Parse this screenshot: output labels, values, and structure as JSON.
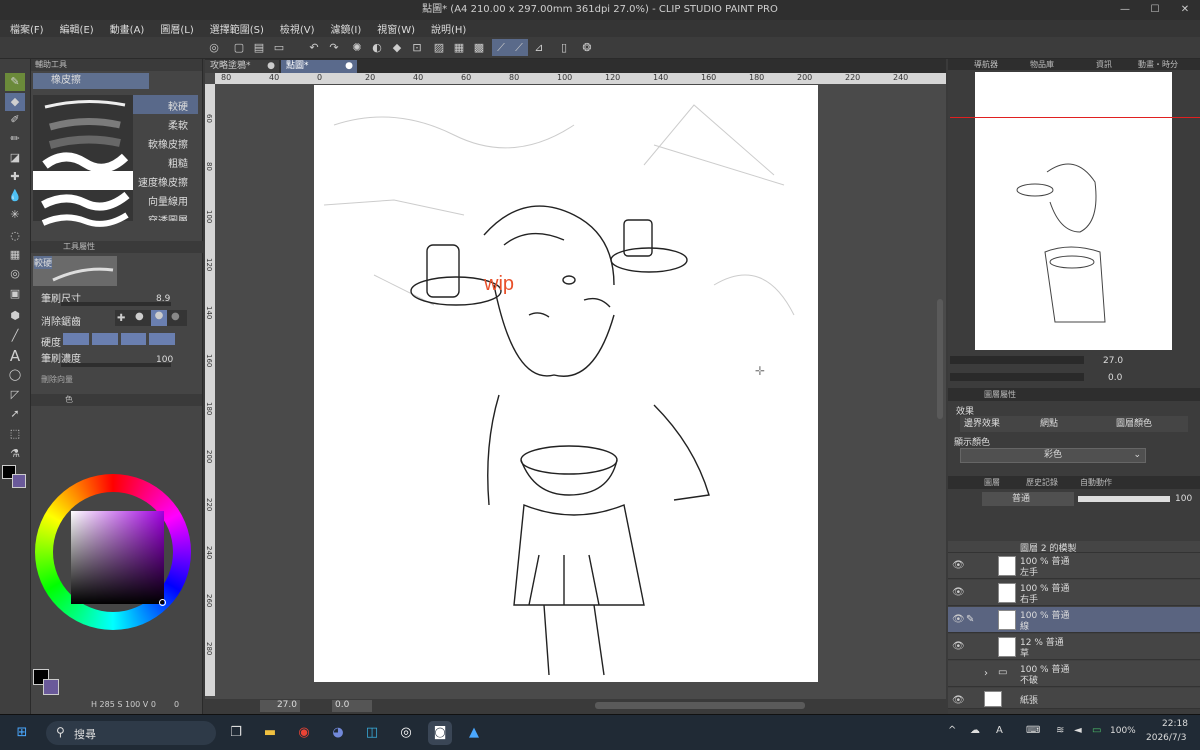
{
  "window": {
    "title": "點圖* (A4 210.00 x 297.00mm 361dpi 27.0%) - CLIP STUDIO PAINT PRO"
  },
  "menu": [
    "檔案(F)",
    "編輯(E)",
    "動畫(A)",
    "圖層(L)",
    "選擇範圍(S)",
    "檢視(V)",
    "濾鏡(I)",
    "視窗(W)",
    "說明(H)"
  ],
  "subtool": {
    "panel_title": "輔助工具",
    "group": "橡皮擦",
    "brushes": [
      "較硬",
      "柔軟",
      "軟橡皮擦",
      "粗糙",
      "速度橡皮擦",
      "向量線用",
      "穿透圖層"
    ],
    "props_title": "工具屬性",
    "props_name": "較硬",
    "brush_size_label": "筆刷尺寸",
    "brush_size": "8.9",
    "antialias_label": "消除鋸齒",
    "hardness_label": "硬度",
    "density_label": "筆刷濃度",
    "density": "100",
    "more_label": "刪除向量"
  },
  "color": {
    "panel_tab": "色",
    "fg": "#000000",
    "bg": "#6a5a9a",
    "bottom_text": "H 285 S 100 V 0",
    "bottom_right": "0"
  },
  "canvas": {
    "tabs": [
      "攻略塗鴉*",
      "點圖*"
    ],
    "ruler_top": [
      "80",
      "40",
      "0",
      "20",
      "40",
      "60",
      "80",
      "100",
      "120",
      "140",
      "160",
      "180",
      "200",
      "220",
      "240"
    ],
    "ruler_left": [
      "60",
      "80",
      "100",
      "120",
      "140",
      "160",
      "180",
      "200",
      "220",
      "240",
      "260",
      "280"
    ],
    "wip_text": "wip",
    "zoom": "27.0",
    "angle": "0.0"
  },
  "right": {
    "tabs_top": [
      "導航器",
      "物品庫",
      "資訊",
      "動畫・時分"
    ],
    "nav_zoom": "27.0",
    "nav_angle": "0.0",
    "layer_prop_title": "圖層屬性",
    "effects_label": "效果",
    "effect_buttons": [
      "邊界效果",
      "網點",
      "圖層顏色"
    ],
    "display_color_label": "顯示顏色",
    "display_color_value": "彩色",
    "layer_tabs": [
      "圖層",
      "歷史記錄",
      "自動動作"
    ],
    "blend_mode": "普通",
    "opacity": "100",
    "layers": [
      {
        "l1": "圖層 2 的模製",
        "l2": ""
      },
      {
        "l1": "100 % 普通",
        "l2": "左手"
      },
      {
        "l1": "100 % 普通",
        "l2": "右手"
      },
      {
        "l1": "100 % 普通",
        "l2": "線"
      },
      {
        "l1": "12 % 普通",
        "l2": "草"
      },
      {
        "l1": "100 % 普通",
        "l2": "不破"
      },
      {
        "l1": "紙張",
        "l2": ""
      }
    ]
  },
  "taskbar": {
    "search": "搜尋",
    "time": "22:18",
    "date": "2026/7/3",
    "battery": "100%",
    "lang": "A"
  }
}
